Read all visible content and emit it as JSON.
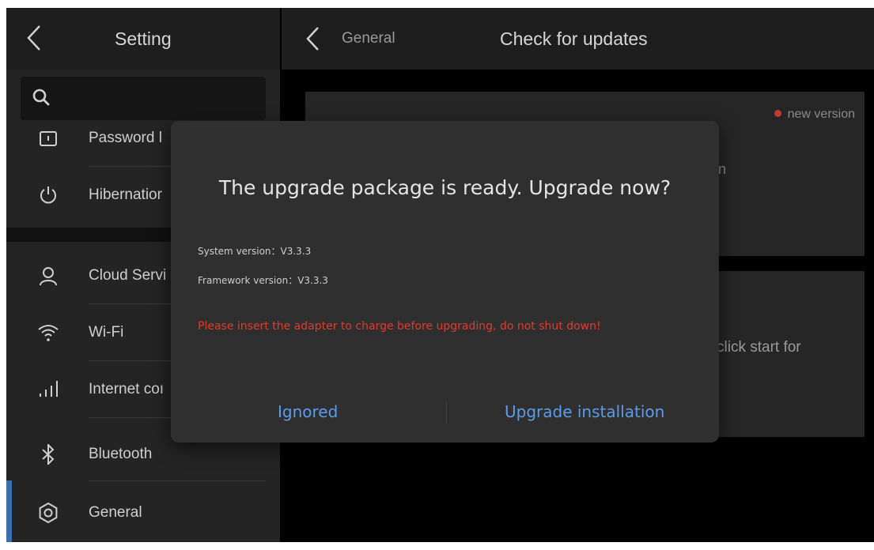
{
  "left_pane": {
    "title": "Setting",
    "menu": [
      {
        "label": "Password l",
        "icon": "password-icon"
      },
      {
        "label": "Hibernatior",
        "icon": "power-icon"
      },
      {
        "label": "Cloud Servi",
        "icon": "user-icon"
      },
      {
        "label": "Wi-Fi",
        "icon": "wifi-icon"
      },
      {
        "label": "Internet coı",
        "icon": "signal-icon"
      },
      {
        "label": "Bluetooth",
        "icon": "bluetooth-icon"
      },
      {
        "label": "General",
        "icon": "gear-icon"
      }
    ]
  },
  "right_pane": {
    "breadcrumb": "General",
    "title": "Check for updates",
    "badge": "new version",
    "peek_text_1": "n",
    "peek_text_2": "click start for"
  },
  "dialog": {
    "title": "The upgrade package is ready. Upgrade now?",
    "system_version": "System version：V3.3.3",
    "framework_version": "Framework version：V3.3.3",
    "warning": "Please insert the adapter to charge before upgrading, do not shut down!",
    "ignore_label": "Ignored",
    "upgrade_label": "Upgrade installation"
  },
  "colors": {
    "accent": "#5b9bea",
    "warning": "#e03a2c",
    "active_indicator": "#3a6fb0",
    "badge_dot": "#c23b2f"
  }
}
